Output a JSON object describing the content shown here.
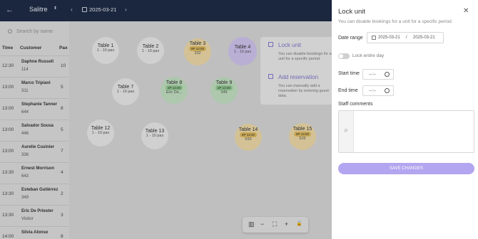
{
  "topbar": {
    "back_icon": "←",
    "venue": "Salitre",
    "caret": "⬍",
    "prev": "‹",
    "date": "2025-03-21",
    "next": "›"
  },
  "search": {
    "placeholder": "Search by name"
  },
  "list_headers": {
    "time": "Time",
    "customer": "Customer",
    "pax": "Pax"
  },
  "reservations": [
    {
      "time": "12:30",
      "name": "Daphne Russell",
      "number": "114",
      "pax": "10"
    },
    {
      "time": "13:00",
      "name": "Marco Tripiani",
      "number": "311",
      "pax": "5"
    },
    {
      "time": "13:00",
      "name": "Stephanie Tanner",
      "number": "644",
      "pax": "8"
    },
    {
      "time": "13:00",
      "name": "Salvador Sousa",
      "number": "446",
      "pax": "5"
    },
    {
      "time": "13:00",
      "name": "Aurelie Cusinier",
      "number": "336",
      "pax": "7"
    },
    {
      "time": "13:30",
      "name": "Ernest Morrison",
      "number": "643",
      "pax": "4"
    },
    {
      "time": "13:30",
      "name": "Esteban Gutiérrez",
      "number": "349",
      "pax": "2"
    },
    {
      "time": "13:30",
      "name": "Eric De Priester",
      "number": "Visitor",
      "pax": "3"
    },
    {
      "time": "14:00",
      "name": "Silvia Alonso",
      "number": "",
      "pax": "8"
    }
  ],
  "tables": [
    {
      "name": "Table 1",
      "cap": "1 - 10 pax"
    },
    {
      "name": "Table 2",
      "cap": "1 - 10 pax"
    },
    {
      "name": "Table 3",
      "pill": "8P 14:00",
      "num": "332",
      "color": "#e6d3a3"
    },
    {
      "name": "Table 4",
      "cap": "1 - 10 pax",
      "color": "#c9bde6"
    },
    {
      "name": "Table 7",
      "cap": "1 - 10 pax"
    },
    {
      "name": "Table 8",
      "pill": "2P 13:30",
      "num": "Eric De...",
      "color": "#bcd9bc"
    },
    {
      "name": "Table 9",
      "pill": "2P 13:30",
      "num": "349",
      "color": "#bcd9bc"
    },
    {
      "name": "Table 12",
      "cap": "1 - 10 pax"
    },
    {
      "name": "Table 13",
      "cap": "1 - 10 pax"
    },
    {
      "name": "Table 14",
      "pill": "5P 14:00",
      "num": "693",
      "color": "#e6d3a3"
    },
    {
      "name": "Table 15",
      "pill": "8P 14:00",
      "num": "526",
      "color": "#e6d3a3"
    }
  ],
  "info_cards": [
    {
      "title": "Lock unit",
      "text": "You can disable bookings for a unit for a specific period."
    },
    {
      "title": "Add reservation",
      "text": "You can manually add a reservation by entering guest data."
    }
  ],
  "toolbar": {
    "sidebar": "▥",
    "zoom_out": "−",
    "fit": "⛶",
    "zoom_in": "+",
    "lock": "🔒"
  },
  "panel": {
    "title": "Lock unit",
    "close": "✕",
    "subtitle": "You can disable bookings for a unit for a specific period.",
    "date_range_label": "Date range",
    "date_from": "2025-03-21",
    "date_sep": "/",
    "date_to": "2025-03-21",
    "lock_entire_day": "Lock entire day",
    "start_time_label": "Start time",
    "start_time_value": "--:--",
    "end_time_label": "End time",
    "end_time_value": "--:--",
    "staff_comments_label": "Staff comments",
    "comments_gutter": "P",
    "save_label": "SAVE CHANGES"
  }
}
